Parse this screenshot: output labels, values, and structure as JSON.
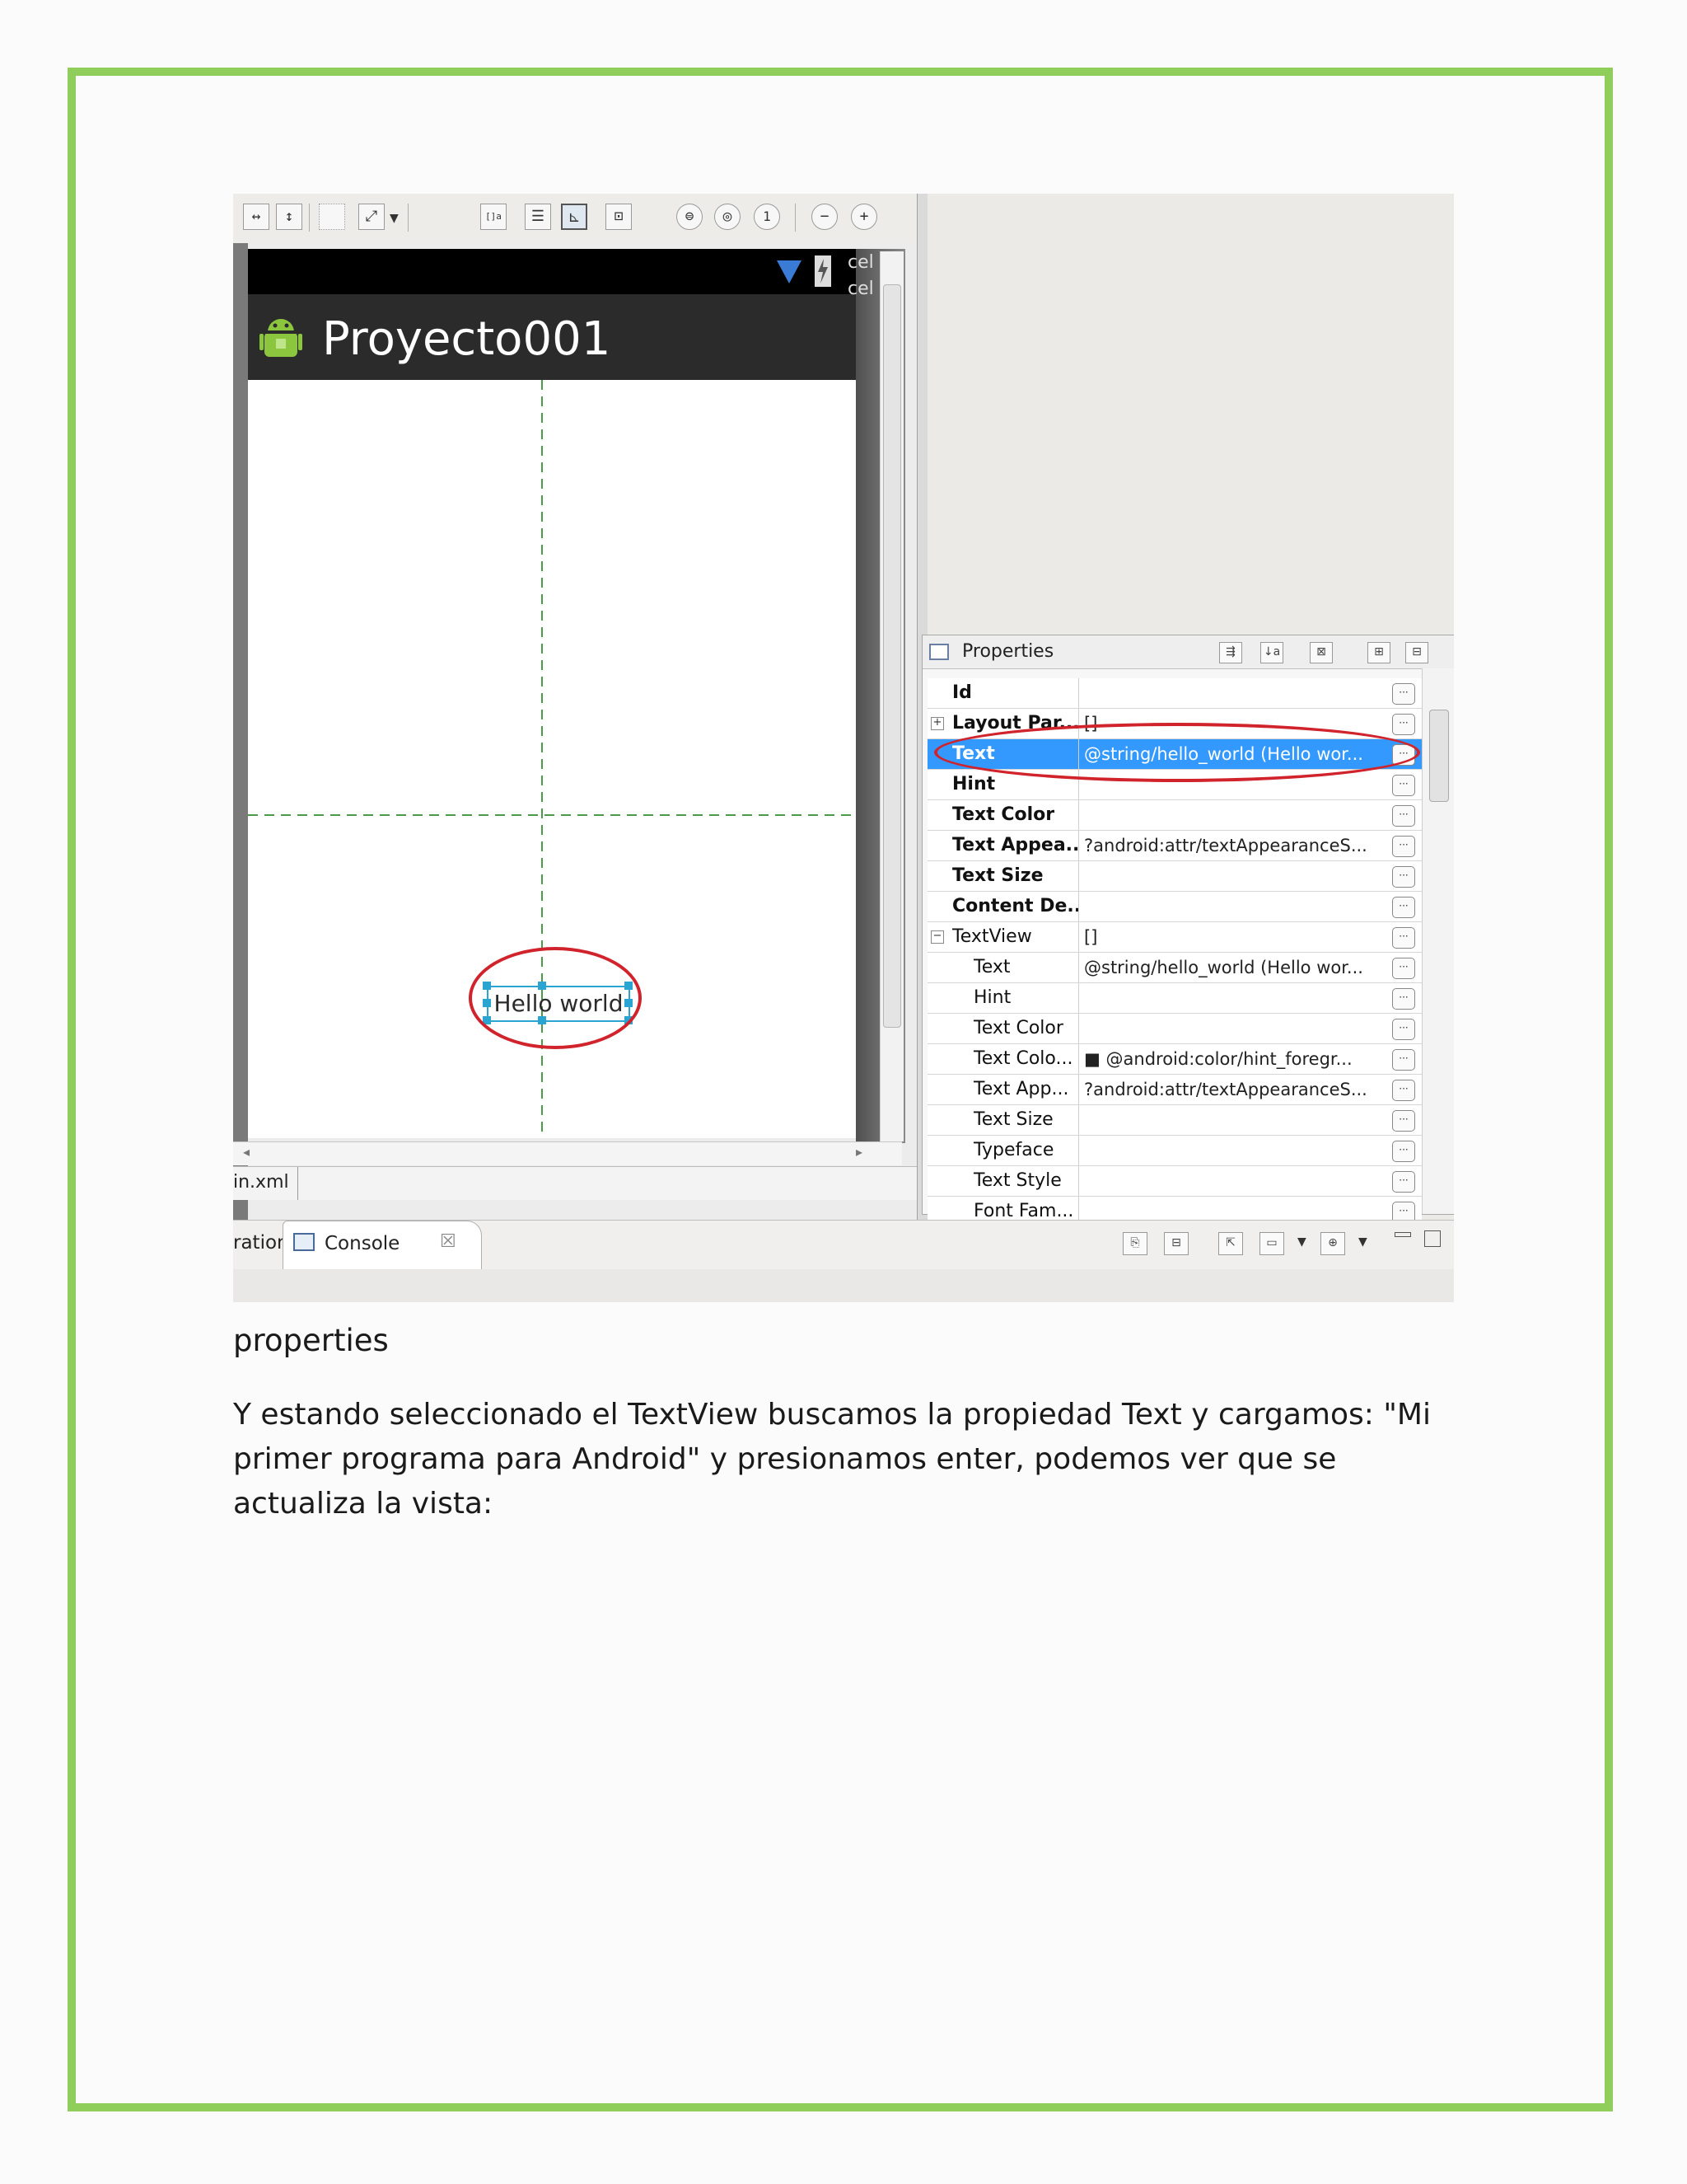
{
  "screenshot": {
    "toolbar_icons": [
      "fit-width-icon",
      "fit-height-icon",
      "select-all-icon",
      "zoom-region-icon",
      "dropdown-arrow-icon",
      "toggle-icon-1",
      "toggle-icon-2",
      "toggle-icon-3",
      "toggle-icon-4",
      "zoom-out-icon",
      "zoom-fit-icon",
      "zoom-actual-icon",
      "zoom-out-small-icon",
      "zoom-in-icon"
    ],
    "device": {
      "app_title": "Proyecto001",
      "side_text_1": "cel",
      "side_text_2": "cel",
      "textview_text": "Hello world"
    },
    "editor_tab": "in.xml",
    "properties": {
      "title": "Properties",
      "rows": [
        {
          "name": "Id",
          "value": "",
          "bold": true,
          "indent": false,
          "expander": ""
        },
        {
          "name": "Layout Par...",
          "value": "[]",
          "bold": true,
          "indent": false,
          "expander": "+"
        },
        {
          "name": "Text",
          "value": "@string/hello_world (Hello wor...",
          "bold": true,
          "indent": false,
          "expander": "",
          "selected": true
        },
        {
          "name": "Hint",
          "value": "",
          "bold": true,
          "indent": false,
          "expander": ""
        },
        {
          "name": "Text Color",
          "value": "",
          "bold": true,
          "indent": false,
          "expander": ""
        },
        {
          "name": "Text Appea...",
          "value": "?android:attr/textAppearanceS...",
          "bold": true,
          "indent": false,
          "expander": ""
        },
        {
          "name": "Text Size",
          "value": "",
          "bold": true,
          "indent": false,
          "expander": ""
        },
        {
          "name": "Content De...",
          "value": "",
          "bold": true,
          "indent": false,
          "expander": ""
        },
        {
          "name": "TextView",
          "value": "[]",
          "bold": false,
          "indent": false,
          "expander": "−"
        },
        {
          "name": "Text",
          "value": "@string/hello_world (Hello wor...",
          "bold": false,
          "indent": true,
          "expander": ""
        },
        {
          "name": "Hint",
          "value": "",
          "bold": false,
          "indent": true,
          "expander": ""
        },
        {
          "name": "Text Color",
          "value": "",
          "bold": false,
          "indent": true,
          "expander": ""
        },
        {
          "name": "Text Colo...",
          "value": "■ @android:color/hint_foregr...",
          "bold": false,
          "indent": true,
          "expander": ""
        },
        {
          "name": "Text App...",
          "value": "?android:attr/textAppearanceS...",
          "bold": false,
          "indent": true,
          "expander": ""
        },
        {
          "name": "Text Size",
          "value": "",
          "bold": false,
          "indent": true,
          "expander": ""
        },
        {
          "name": "Typeface",
          "value": "",
          "bold": false,
          "indent": true,
          "expander": ""
        },
        {
          "name": "Text Style",
          "value": "",
          "bold": false,
          "indent": true,
          "expander": ""
        },
        {
          "name": "Font Fam...",
          "value": "",
          "bold": false,
          "indent": true,
          "expander": ""
        }
      ],
      "row_button": "···"
    },
    "console_bar": {
      "left_tab_fragment": "ration",
      "console_label": "Console",
      "close_glyph": "☒"
    },
    "colors": {
      "highlight_ellipse": "#d0232b",
      "selection": "#3399ff",
      "guide_lines": "#4a9a4a",
      "page_border": "#8fce5a"
    }
  },
  "caption": "properties",
  "paragraph_lines": [
    "Y estando seleccionado el TextView buscamos la propiedad Text y cargamos: \"Mi",
    "primer programa para Android\" y presionamos enter, podemos ver que se",
    "actualiza la vista:"
  ]
}
